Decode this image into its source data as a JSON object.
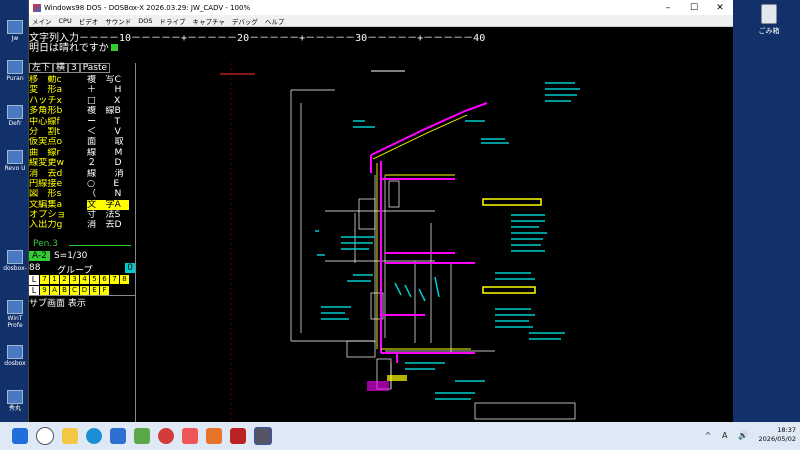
{
  "window": {
    "title": "Windows98 DOS - DOSBox-X 2026.03.29: JW_CADV - 100%",
    "menu": [
      "メイン",
      "CPU",
      "ビデオ",
      "サウンド",
      "DOS",
      "ドライブ",
      "キャプチャ",
      "デバッグ",
      "ヘルプ"
    ]
  },
  "desktop": {
    "icons": [
      "Jw",
      "Puran",
      "Defr",
      "Revo U",
      "dosbox-",
      "WinT Profe",
      "dosbox",
      "秀丸"
    ],
    "recycle_bin": "ごみ箱"
  },
  "ruler": "文字列入力－－－－10－－－－－+－－－－－20－－－－－+－－－－－30－－－－－+－－－－－40",
  "input_text": "明日は晴れですか",
  "tabs": [
    "左下",
    "横",
    "3",
    "Paste"
  ],
  "menu_grid": [
    [
      "移　動c",
      "複　写C"
    ],
    [
      "変　形a",
      "＋　　H"
    ],
    [
      "ハッチx",
      "□　　X"
    ],
    [
      "多角形b",
      "複　線B"
    ],
    [
      "中心線f",
      "ー　　T"
    ],
    [
      "分　割t",
      "＜　　V"
    ],
    [
      "仮実点o",
      "面　　取"
    ],
    [
      "曲　線r",
      "線　　M"
    ],
    [
      "線変更w",
      "２　　D"
    ],
    [
      "消　去d",
      "線　　消"
    ],
    [
      "円線接e",
      "○　　E"
    ],
    [
      "図　形s",
      "（　　N"
    ],
    [
      "文編集a",
      "文　字A"
    ],
    [
      "オプショ",
      "寸　法S"
    ],
    [
      "入出力g",
      "消　去D"
    ]
  ],
  "pen": "Pen.3",
  "layer": {
    "name": "A-2",
    "scale": "S=1/30"
  },
  "group": {
    "number": "88",
    "label": "グループ",
    "value": "0"
  },
  "layer_rows": [
    {
      "key": "L",
      "nums": [
        "7",
        "1",
        "2",
        "3",
        "4",
        "5",
        "6",
        "7",
        "8"
      ]
    },
    {
      "key": "L",
      "nums": [
        "9",
        "A",
        "B",
        "C",
        "D",
        "E",
        "F"
      ]
    }
  ],
  "sub_label": "サブ画面 表示",
  "taskbar": {
    "time": "18:37",
    "date": "2026/05/02"
  },
  "colors": {
    "wall": "#ff00ff",
    "insulation": "#ffff00",
    "leader": "#00cccc",
    "structure": "#ffffff"
  }
}
